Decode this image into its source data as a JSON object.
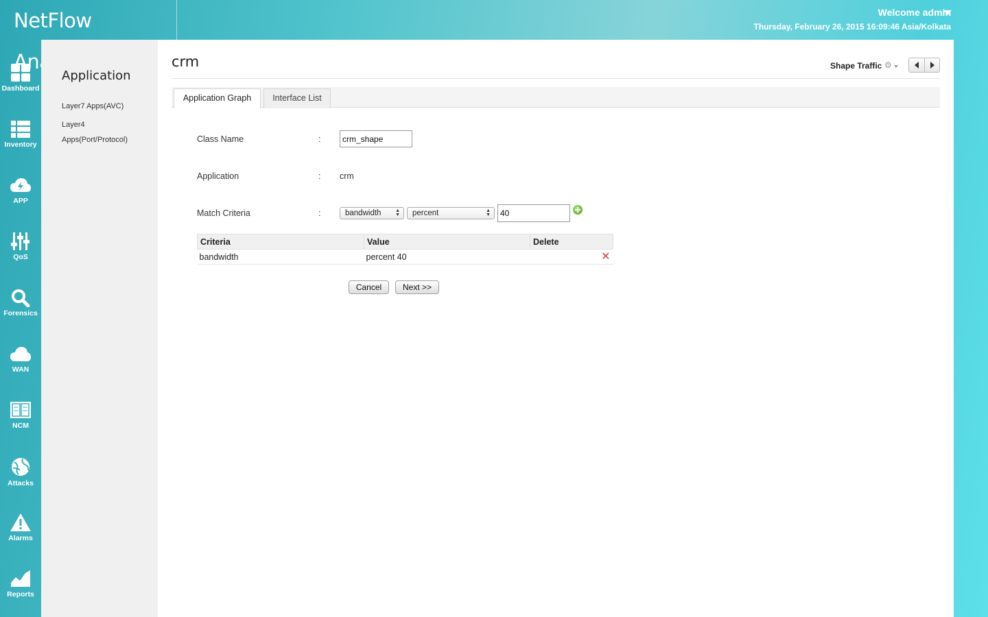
{
  "header": {
    "app_title": "NetFlow Analyzer",
    "welcome": "Welcome admin",
    "datetime": "Thursday, February 26, 2015 16:09:46 Asia/Kolkata"
  },
  "nav": {
    "items": [
      {
        "label": "Dashboard",
        "icon": "dashboard-icon"
      },
      {
        "label": "Inventory",
        "icon": "inventory-icon"
      },
      {
        "label": "APP",
        "icon": "app-cloud-icon"
      },
      {
        "label": "QoS",
        "icon": "qos-sliders-icon"
      },
      {
        "label": "Forensics",
        "icon": "search-icon"
      },
      {
        "label": "WAN",
        "icon": "cloud-icon"
      },
      {
        "label": "NCM",
        "icon": "ncm-icon"
      },
      {
        "label": "Attacks",
        "icon": "attacks-globe-icon"
      },
      {
        "label": "Alarms",
        "icon": "warning-icon"
      },
      {
        "label": "Reports",
        "icon": "reports-chart-icon"
      }
    ]
  },
  "subnav": {
    "title": "Application",
    "links": [
      "Layer7 Apps(AVC)",
      "Layer4 Apps(Port/Protocol)"
    ]
  },
  "main": {
    "title": "crm",
    "shape_traffic": "Shape Traffic",
    "tabs": [
      "Application Graph",
      "Interface List"
    ],
    "form": {
      "class_name_label": "Class Name",
      "class_name_value": "crm_shape",
      "application_label": "Application",
      "application_value": "crm",
      "match_criteria_label": "Match Criteria",
      "criteria_select": "bandwidth",
      "unit_select": "percent",
      "value_input": "40",
      "colon": ":"
    },
    "table": {
      "headers": [
        "Criteria",
        "Value",
        "Delete"
      ],
      "rows": [
        {
          "criteria": "bandwidth",
          "value": "percent 40"
        }
      ]
    },
    "buttons": {
      "cancel": "Cancel",
      "next": "Next >>"
    }
  }
}
